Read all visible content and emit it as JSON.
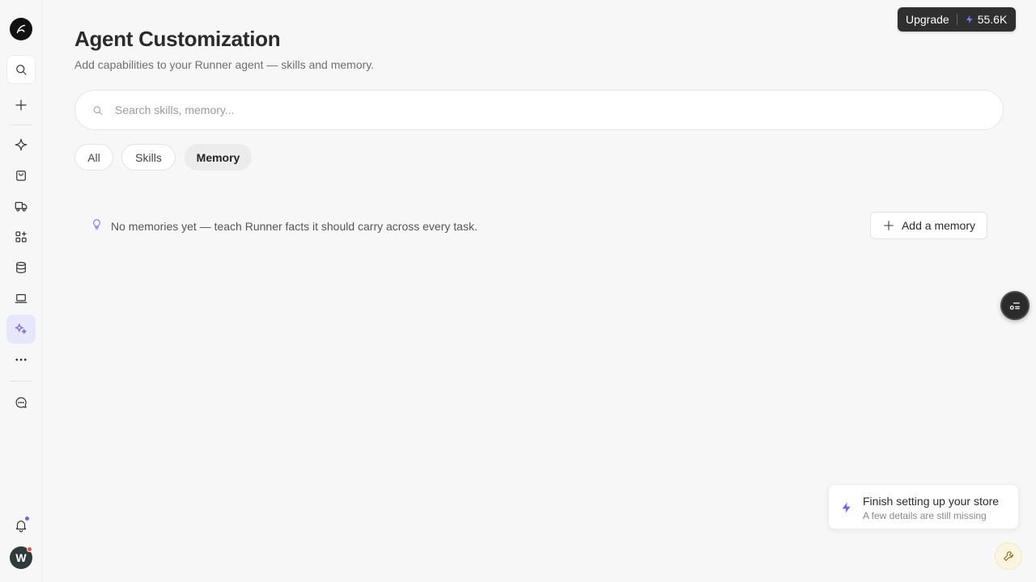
{
  "header": {
    "title": "Agent Customization",
    "subtitle": "Add capabilities to your Runner agent — skills and memory."
  },
  "search": {
    "placeholder": "Search skills, memory..."
  },
  "filters": [
    {
      "label": "All",
      "active": false
    },
    {
      "label": "Skills",
      "active": false
    },
    {
      "label": "Memory",
      "active": true
    }
  ],
  "memory": {
    "empty_text": "No memories yet — teach Runner facts it should carry across every task.",
    "add_label": "Add a memory"
  },
  "upgrade": {
    "label": "Upgrade",
    "credits": "55.6K"
  },
  "setup": {
    "title": "Finish setting up your store",
    "subtitle": "A few details are still missing"
  },
  "user": {
    "avatar_initial": "W"
  },
  "colors": {
    "accent": "#6c63ff",
    "background": "#f7f7f7",
    "notification_dot": "#5a6cff",
    "avatar_dot": "#e5533d"
  },
  "sidebar": {
    "icons": [
      "logo-icon",
      "search-icon",
      "plus-icon",
      "sparkle-icon",
      "shopping-bag-icon",
      "truck-icon",
      "apps-icon",
      "database-icon",
      "laptop-icon",
      "agent-sparkles-icon",
      "more-icon",
      "chat-icon",
      "bell-icon"
    ]
  }
}
